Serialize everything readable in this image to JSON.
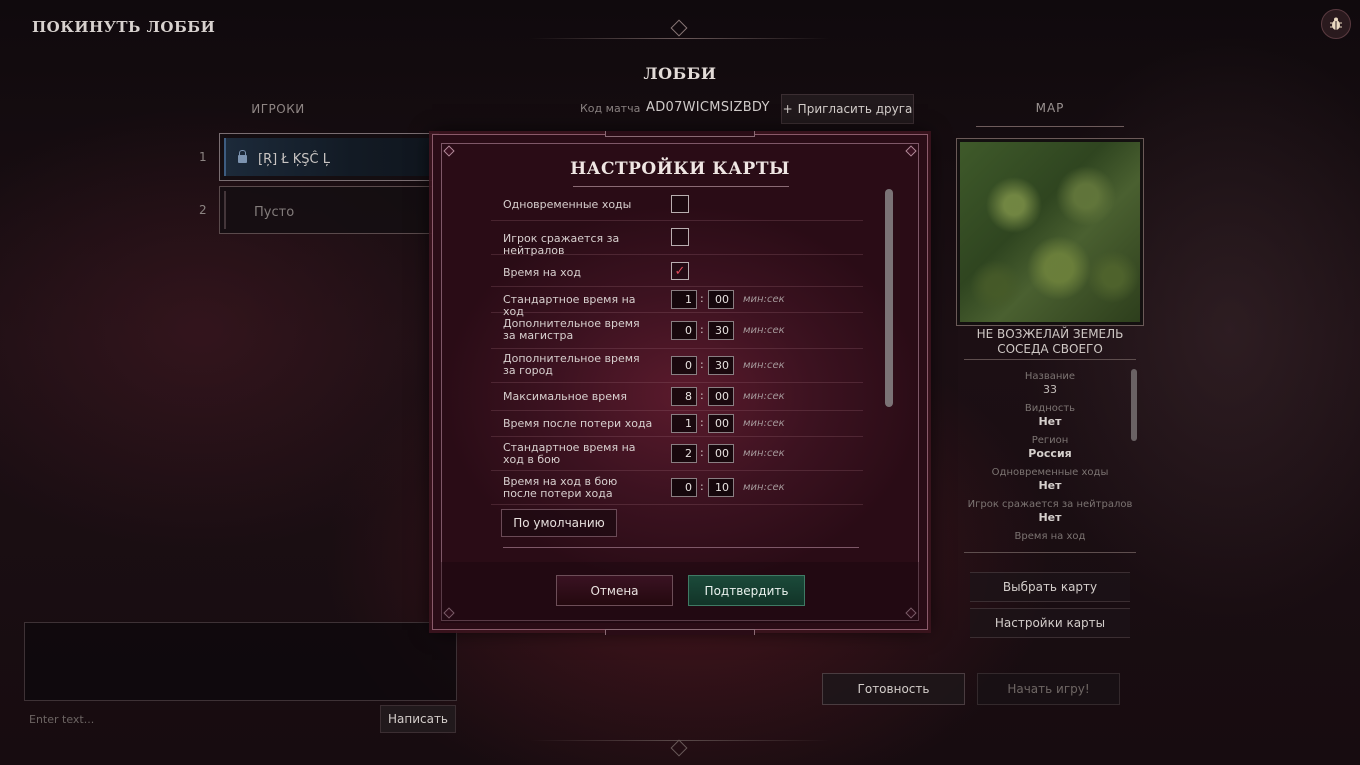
{
  "header": {
    "leave_label": "ПОКИНУТЬ ЛОББИ",
    "lobby_title": "ЛОББИ",
    "bug_icon": "bug-icon"
  },
  "players": {
    "heading": "ИГРОКИ",
    "slots": [
      {
        "number": "1",
        "name": "[Ŗ] Ł ĶŞĈ  Ļ",
        "locked": true
      },
      {
        "number": "2",
        "name": "Пусто",
        "locked": false
      }
    ]
  },
  "match": {
    "code_label": "Код матча",
    "code": "AD07WICMSIZBDY",
    "invite_icon": "+",
    "invite_label": "Пригласить друга"
  },
  "chat": {
    "placeholder": "Enter text...",
    "send_label": "Написать"
  },
  "map_panel": {
    "heading": "MAP",
    "map_name": "НЕ ВОЗЖЕЛАЙ ЗЕМЕЛЬ СОСЕДА СВОЕГО",
    "info": [
      {
        "label": "Название",
        "value": "33"
      },
      {
        "label": "Видность",
        "value": "Нет"
      },
      {
        "label": "Регион",
        "value": "Россия"
      },
      {
        "label": "Одновременные ходы",
        "value": "Нет"
      },
      {
        "label": "Игрок сражается за нейтралов",
        "value": "Нет"
      },
      {
        "label": "Время на ход",
        "value": ""
      }
    ],
    "pick_map_label": "Выбрать карту",
    "map_settings_label": "Настройки карты"
  },
  "actions": {
    "ready_label": "Готовность",
    "start_label": "Начать игру!"
  },
  "modal": {
    "title": "НАСТРОЙКИ КАРТЫ",
    "rows": [
      {
        "label": "Одновременные ходы",
        "type": "checkbox",
        "checked": false
      },
      {
        "label": "Игрок сражается за нейтралов",
        "type": "checkbox",
        "checked": false
      },
      {
        "label": "Время на ход",
        "type": "checkbox",
        "checked": true,
        "check_glyph": "✓"
      },
      {
        "label": "Стандартное время на ход",
        "type": "time",
        "min": "1",
        "sec": "00",
        "unit": "мин:сек"
      },
      {
        "label": "Дополнительное время за магистра",
        "type": "time",
        "min": "0",
        "sec": "30",
        "unit": "мин:сек"
      },
      {
        "label": "Дополнительное время за город",
        "type": "time",
        "min": "0",
        "sec": "30",
        "unit": "мин:сек"
      },
      {
        "label": "Максимальное время",
        "type": "time",
        "min": "8",
        "sec": "00",
        "unit": "мин:сек"
      },
      {
        "label": "Время после потери хода",
        "type": "time",
        "min": "1",
        "sec": "00",
        "unit": "мин:сек"
      },
      {
        "label": "Стандартное время на ход в бою",
        "type": "time",
        "min": "2",
        "sec": "00",
        "unit": "мин:сек"
      },
      {
        "label": "Время на ход в бою после потери хода",
        "type": "time",
        "min": "0",
        "sec": "10",
        "unit": "мин:сек"
      }
    ],
    "time_separator": ":",
    "default_label": "По умолчанию",
    "cancel_label": "Отмена",
    "confirm_label": "Подтвердить"
  },
  "colors": {
    "confirm": "#1b4a3a",
    "check": "#e04a5a",
    "modal_bg": "#3c1220"
  }
}
